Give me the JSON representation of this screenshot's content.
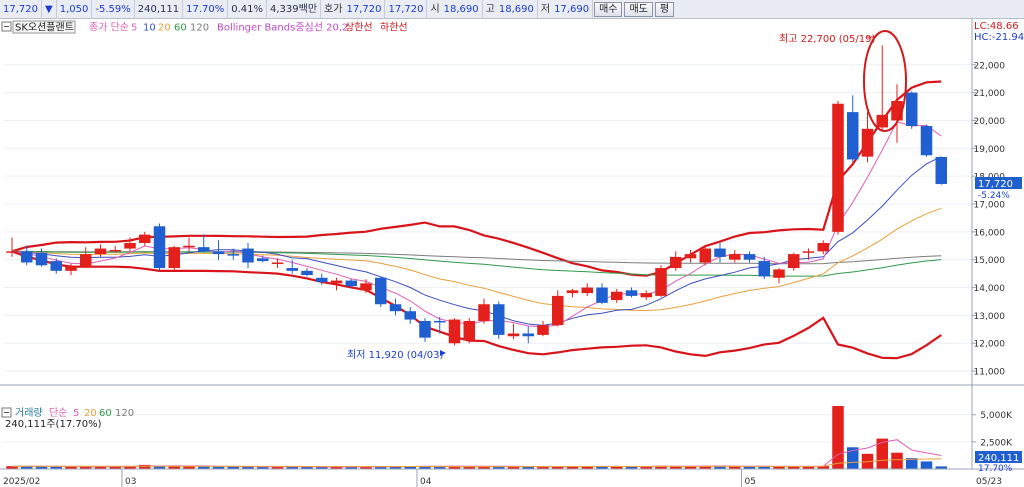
{
  "topbar": {
    "price": "17,720",
    "arrow": "▼",
    "change": "1,050",
    "change_pct": "-5.59%",
    "volume": "240,111",
    "vol_ratio": "17.70%",
    "turnover_pct": "0.41%",
    "amount": "4,339백만",
    "quote_label": "호가",
    "bid": "17,720",
    "ask": "17,720",
    "open_label": "시",
    "open": "18,690",
    "high_label": "고",
    "high": "18,690",
    "low_label": "저",
    "low": "17,690",
    "buy_btn": "매수",
    "sell_btn": "매도",
    "eval_btn": "평"
  },
  "legend": {
    "stock_name": "SK오션플랜트",
    "ma_title": "종가 단순",
    "ma_periods": [
      "5",
      "10",
      "20",
      "60",
      "120"
    ],
    "bb_title": "Bollinger Bands중심선 20,2",
    "bb_upper": "상한선",
    "bb_lower": "하한선"
  },
  "volume_legend": {
    "title": "거래량",
    "ma_title": "단순",
    "ma_periods": [
      "5",
      "20",
      "60",
      "120"
    ],
    "current": "240,111주(17.70%)"
  },
  "right_labels": {
    "lc": "LC:48.66",
    "hc": "HC:-21.94",
    "current_price": "17,720",
    "current_pct": "-5.24%",
    "current_vol": "240,111",
    "current_vol_pct": "17.70%"
  },
  "annotations": {
    "high": "최고 22,700 (05/19)",
    "low": "최저 11,920 (04/03)"
  },
  "colors": {
    "up": "#e3201b",
    "down": "#1f5fd0",
    "ma5": "#e05fb6",
    "ma10": "#3a4fc0",
    "ma20": "#e8a03a",
    "ma60": "#2f9a4a",
    "ma120": "#7c7c7c",
    "bollinger": "#d8141a"
  },
  "chart_data": {
    "type": "candlestick",
    "price_axis": {
      "ylim": [
        10500,
        23500
      ],
      "ticks": [
        "11,000",
        "12,000",
        "13,000",
        "14,000",
        "15,000",
        "16,000",
        "17,000",
        "18,000",
        "19,000",
        "20,000",
        "21,000",
        "22,000"
      ]
    },
    "volume_axis": {
      "ylim": [
        0,
        7000
      ],
      "ticks": [
        "2,500K",
        "5,000K"
      ]
    },
    "x_ticks": [
      {
        "i": 0,
        "label": "2025/02"
      },
      {
        "i": 8,
        "label": "03"
      },
      {
        "i": 28,
        "label": "04"
      },
      {
        "i": 50,
        "label": "05"
      },
      {
        "i": 65,
        "label": "05/23"
      }
    ],
    "candles": [
      {
        "o": 15250,
        "h": 15800,
        "l": 15100,
        "c": 15300,
        "v": 260
      },
      {
        "o": 15300,
        "h": 15500,
        "l": 14800,
        "c": 14900,
        "v": 240
      },
      {
        "o": 15250,
        "h": 15400,
        "l": 14750,
        "c": 14800,
        "v": 220
      },
      {
        "o": 14950,
        "h": 15050,
        "l": 14500,
        "c": 14600,
        "v": 200
      },
      {
        "o": 14600,
        "h": 14850,
        "l": 14450,
        "c": 14750,
        "v": 210
      },
      {
        "o": 14750,
        "h": 15450,
        "l": 14700,
        "c": 15200,
        "v": 240
      },
      {
        "o": 15200,
        "h": 15550,
        "l": 15100,
        "c": 15400,
        "v": 230
      },
      {
        "o": 15350,
        "h": 15500,
        "l": 15250,
        "c": 15350,
        "v": 220
      },
      {
        "o": 15400,
        "h": 15800,
        "l": 15300,
        "c": 15600,
        "v": 250
      },
      {
        "o": 15600,
        "h": 16000,
        "l": 15500,
        "c": 15900,
        "v": 380
      },
      {
        "o": 16200,
        "h": 16300,
        "l": 14600,
        "c": 14700,
        "v": 310
      },
      {
        "o": 14700,
        "h": 15500,
        "l": 14600,
        "c": 15450,
        "v": 270
      },
      {
        "o": 15450,
        "h": 15800,
        "l": 15300,
        "c": 15500,
        "v": 230
      },
      {
        "o": 15450,
        "h": 15900,
        "l": 15250,
        "c": 15300,
        "v": 220
      },
      {
        "o": 15300,
        "h": 15700,
        "l": 15000,
        "c": 15200,
        "v": 210
      },
      {
        "o": 15200,
        "h": 15400,
        "l": 15000,
        "c": 15150,
        "v": 200
      },
      {
        "o": 15400,
        "h": 15600,
        "l": 14700,
        "c": 14900,
        "v": 260
      },
      {
        "o": 15050,
        "h": 15150,
        "l": 14900,
        "c": 14950,
        "v": 180
      },
      {
        "o": 14850,
        "h": 15050,
        "l": 14700,
        "c": 14900,
        "v": 190
      },
      {
        "o": 14700,
        "h": 15000,
        "l": 14500,
        "c": 14600,
        "v": 200
      },
      {
        "o": 14600,
        "h": 14700,
        "l": 14400,
        "c": 14450,
        "v": 190
      },
      {
        "o": 14350,
        "h": 14500,
        "l": 14100,
        "c": 14200,
        "v": 200
      },
      {
        "o": 14150,
        "h": 14350,
        "l": 13900,
        "c": 14250,
        "v": 190
      },
      {
        "o": 14250,
        "h": 14300,
        "l": 14000,
        "c": 14050,
        "v": 180
      },
      {
        "o": 13900,
        "h": 14300,
        "l": 13800,
        "c": 14150,
        "v": 200
      },
      {
        "o": 14350,
        "h": 14400,
        "l": 13300,
        "c": 13400,
        "v": 260
      },
      {
        "o": 13400,
        "h": 13600,
        "l": 13000,
        "c": 13150,
        "v": 240
      },
      {
        "o": 13150,
        "h": 13300,
        "l": 12700,
        "c": 12850,
        "v": 250
      },
      {
        "o": 12800,
        "h": 12900,
        "l": 12050,
        "c": 12200,
        "v": 280
      },
      {
        "o": 12800,
        "h": 12950,
        "l": 12350,
        "c": 12750,
        "v": 230
      },
      {
        "o": 12000,
        "h": 12900,
        "l": 11920,
        "c": 12850,
        "v": 290
      },
      {
        "o": 12100,
        "h": 12900,
        "l": 12000,
        "c": 12800,
        "v": 260
      },
      {
        "o": 12800,
        "h": 13600,
        "l": 12700,
        "c": 13400,
        "v": 250
      },
      {
        "o": 13400,
        "h": 13500,
        "l": 12150,
        "c": 12300,
        "v": 240
      },
      {
        "o": 12250,
        "h": 12700,
        "l": 12150,
        "c": 12350,
        "v": 200
      },
      {
        "o": 12350,
        "h": 12600,
        "l": 12000,
        "c": 12250,
        "v": 190
      },
      {
        "o": 12300,
        "h": 12800,
        "l": 12250,
        "c": 12650,
        "v": 220
      },
      {
        "o": 12650,
        "h": 13900,
        "l": 12600,
        "c": 13700,
        "v": 260
      },
      {
        "o": 13800,
        "h": 13950,
        "l": 13650,
        "c": 13900,
        "v": 230
      },
      {
        "o": 13800,
        "h": 14150,
        "l": 13700,
        "c": 14000,
        "v": 240
      },
      {
        "o": 14000,
        "h": 14150,
        "l": 13400,
        "c": 13450,
        "v": 230
      },
      {
        "o": 13550,
        "h": 13950,
        "l": 13450,
        "c": 13850,
        "v": 220
      },
      {
        "o": 13900,
        "h": 14000,
        "l": 13650,
        "c": 13700,
        "v": 200
      },
      {
        "o": 13650,
        "h": 13900,
        "l": 13550,
        "c": 13800,
        "v": 210
      },
      {
        "o": 13700,
        "h": 14800,
        "l": 13650,
        "c": 14700,
        "v": 300
      },
      {
        "o": 14700,
        "h": 15300,
        "l": 14600,
        "c": 15100,
        "v": 290
      },
      {
        "o": 15050,
        "h": 15350,
        "l": 14900,
        "c": 15200,
        "v": 260
      },
      {
        "o": 14900,
        "h": 15450,
        "l": 14800,
        "c": 15400,
        "v": 280
      },
      {
        "o": 15400,
        "h": 15600,
        "l": 14900,
        "c": 15100,
        "v": 250
      },
      {
        "o": 15000,
        "h": 15350,
        "l": 14900,
        "c": 15200,
        "v": 240
      },
      {
        "o": 15200,
        "h": 15300,
        "l": 14900,
        "c": 15000,
        "v": 230
      },
      {
        "o": 14950,
        "h": 15100,
        "l": 14300,
        "c": 14400,
        "v": 260
      },
      {
        "o": 14350,
        "h": 14700,
        "l": 14150,
        "c": 14650,
        "v": 240
      },
      {
        "o": 14700,
        "h": 15250,
        "l": 14600,
        "c": 15200,
        "v": 250
      },
      {
        "o": 15250,
        "h": 15400,
        "l": 15000,
        "c": 15300,
        "v": 230
      },
      {
        "o": 15300,
        "h": 15700,
        "l": 15200,
        "c": 15600,
        "v": 260
      },
      {
        "o": 16000,
        "h": 20700,
        "l": 15900,
        "c": 20600,
        "v": 5800
      },
      {
        "o": 20300,
        "h": 20900,
        "l": 18500,
        "c": 18600,
        "v": 2000
      },
      {
        "o": 18700,
        "h": 20300,
        "l": 18500,
        "c": 19700,
        "v": 1400
      },
      {
        "o": 19750,
        "h": 22700,
        "l": 19600,
        "c": 20200,
        "v": 2800
      },
      {
        "o": 20000,
        "h": 21300,
        "l": 19200,
        "c": 20700,
        "v": 1500
      },
      {
        "o": 21000,
        "h": 21050,
        "l": 19700,
        "c": 19800,
        "v": 1000
      },
      {
        "o": 19800,
        "h": 19850,
        "l": 18700,
        "c": 18750,
        "v": 700
      },
      {
        "o": 18690,
        "h": 18690,
        "l": 17690,
        "c": 17720,
        "v": 240
      }
    ]
  }
}
